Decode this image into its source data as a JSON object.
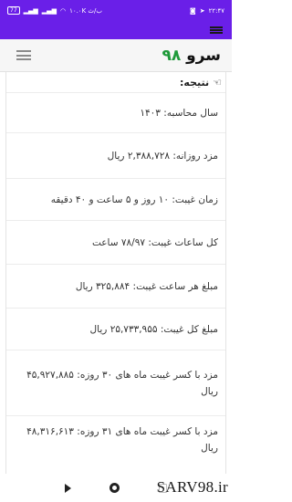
{
  "status_bar": {
    "battery": "77",
    "speed": "۱۰.۰K ب/ث",
    "time": "۲۲:۴۷"
  },
  "header": {
    "logo_number": "۹۸",
    "logo_word": "سرو"
  },
  "result": {
    "title": "نتیجه:",
    "rows": [
      {
        "label": "سال محاسبه:",
        "value": "۱۴۰۳"
      },
      {
        "label": "مزد روزانه:",
        "value": "۲,۳۸۸,۷۲۸ ریال"
      },
      {
        "label": "زمان غیبت:",
        "value": "۱۰ روز و ۵ ساعت و ۴۰ دقیقه"
      },
      {
        "label": "کل ساعات غیبت:",
        "value": "۷۸/۹۷ ساعت"
      },
      {
        "label": "مبلغ هر ساعت غیبت:",
        "value": "۳۲۵,۸۸۴ ریال"
      },
      {
        "label": "مبلغ کل غیبت:",
        "value": "۲۵,۷۳۳,۹۵۵ ریال"
      },
      {
        "label": "مزد با کسر غیبت ماه های ۳۰ روزه:",
        "value": "۴۵,۹۲۷,۸۸۵ ریال"
      },
      {
        "label": "مزد با کسر غیبت ماه های ۳۱ روزه:",
        "value": "۴۸,۳۱۶,۶۱۳ ریال"
      }
    ]
  },
  "watermark": "SARV98.ir"
}
